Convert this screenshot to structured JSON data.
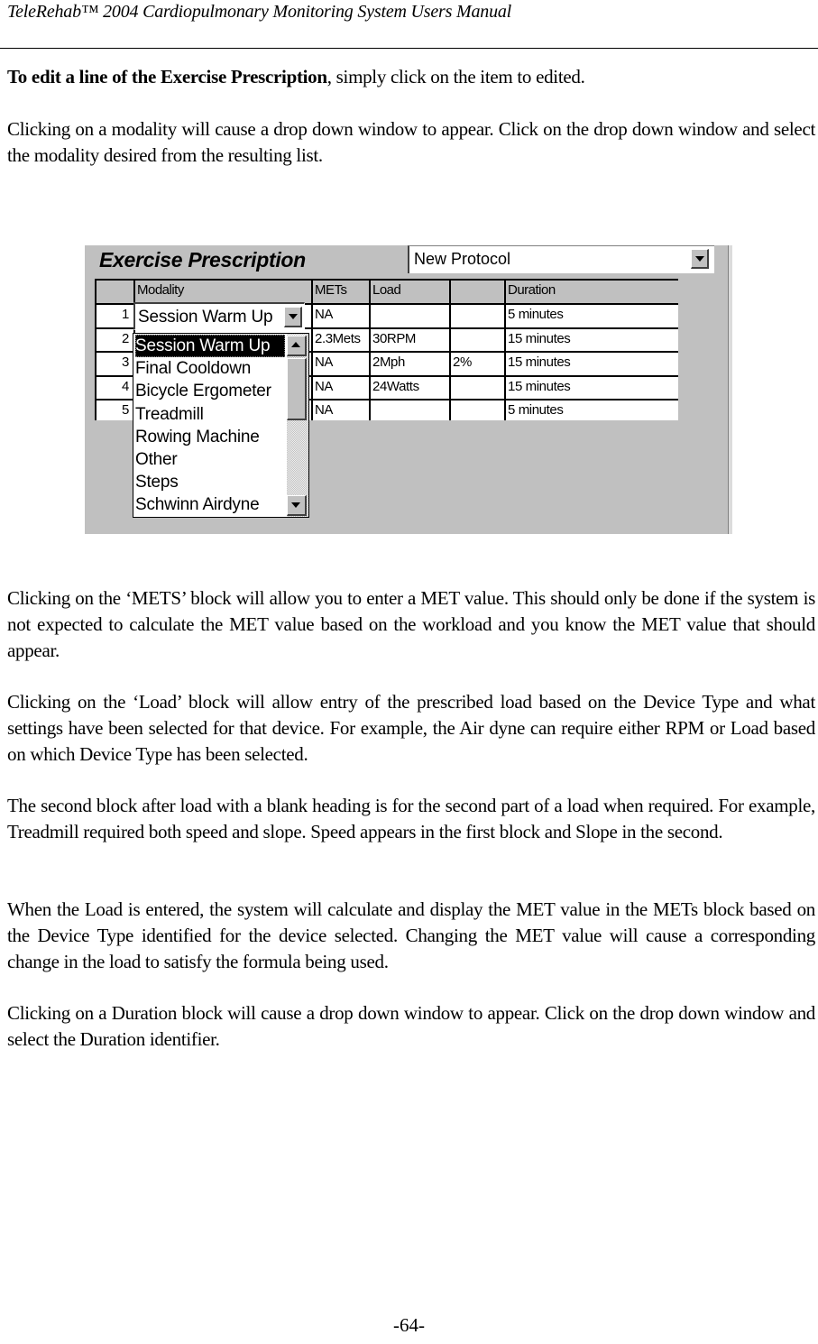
{
  "header": {
    "title": "TeleRehab™ 2004 Cardiopulmonary Monitoring System Users Manual"
  },
  "paragraphs": {
    "p1_bold": "To edit a line of the Exercise Prescription",
    "p1_rest": ", simply click on the item to edited.",
    "p2": "Clicking on a modality will cause a drop down window to appear. Click on the drop down window and select the modality desired from the resulting list.",
    "p3": "Clicking on the ‘METS’ block will allow you to enter a MET value. This should only be done if the system is not expected to calculate the MET value based on the workload and you know the MET value that should appear.",
    "p4": "Clicking on the ‘Load’ block will allow entry of the prescribed load based on the Device Type and what settings have been selected for that device. For example, the Air dyne can require either RPM or Load based on which Device Type has been selected.",
    "p5": "The second block after load with a blank heading is for the second part of a load when required. For example, Treadmill required both speed and slope. Speed appears in the first block and Slope in the second.",
    "p6": "When the Load is entered, the system will calculate and display the MET value in the METs block based on the Device Type identified for the device selected. Changing the MET value will cause a corresponding change in the load to satisfy the formula being used.",
    "p7": "Clicking on a Duration block will cause a drop down window to appear. Click on the drop down window and select the Duration identifier."
  },
  "screenshot": {
    "title": "Exercise Prescription",
    "protocol_value": "New Protocol",
    "columns": [
      "",
      "Modality",
      "METs",
      "Load",
      "",
      "Duration"
    ],
    "rows": [
      {
        "num": "1",
        "modality": "Session Warm Up",
        "mets": "NA",
        "load": "",
        "load2": "",
        "duration": "5 minutes"
      },
      {
        "num": "2",
        "modality": "",
        "mets": "2.3Mets",
        "load": "30RPM",
        "load2": "",
        "duration": "15 minutes"
      },
      {
        "num": "3",
        "modality": "",
        "mets": "NA",
        "load": "2Mph",
        "load2": "2%",
        "duration": "15 minutes"
      },
      {
        "num": "4",
        "modality": "",
        "mets": "NA",
        "load": "24Watts",
        "load2": "",
        "duration": "15 minutes"
      },
      {
        "num": "5",
        "modality": "",
        "mets": "NA",
        "load": "",
        "load2": "",
        "duration": "5 minutes"
      }
    ],
    "combo_value": "Session Warm Up",
    "modality_options": [
      "Session Warm Up",
      "Final Cooldown",
      "Bicycle Ergometer",
      "Treadmill",
      "Rowing Machine",
      "Other",
      "Steps",
      "Schwinn Airdyne"
    ],
    "selected_option_index": 0
  },
  "footer": {
    "page_number": "-64-"
  }
}
